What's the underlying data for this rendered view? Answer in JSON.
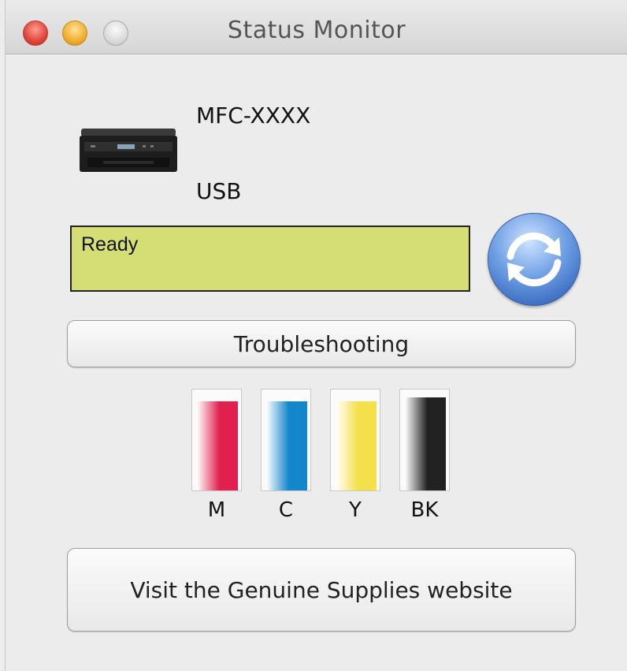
{
  "window": {
    "title": "Status Monitor"
  },
  "device": {
    "model": "MFC-XXXX",
    "connection": "USB"
  },
  "status": {
    "text": "Ready",
    "color": "#d4de74"
  },
  "buttons": {
    "troubleshooting": "Troubleshooting",
    "visit_supplies": "Visit the Genuine Supplies website"
  },
  "ink": [
    {
      "label": "M",
      "level": 0.88,
      "color": "#e0204e"
    },
    {
      "label": "C",
      "level": 0.88,
      "color": "#1486cc"
    },
    {
      "label": "Y",
      "level": 0.88,
      "color": "#f3e04a"
    },
    {
      "label": "BK",
      "level": 0.92,
      "color": "#222222"
    }
  ]
}
